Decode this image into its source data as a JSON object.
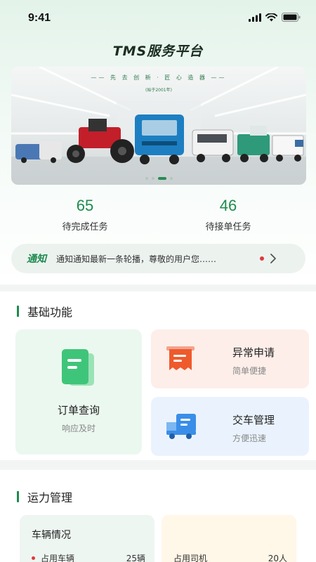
{
  "status": {
    "time": "9:41"
  },
  "app": {
    "title": "TMS服务平台"
  },
  "banner": {
    "slogan": "—— 先 去 创 新 · 匠 心 造 器 ——",
    "subtitle": "(始于2001年)",
    "slide_count": 4,
    "active_slide": 3
  },
  "stats": [
    {
      "value": "65",
      "label": "待完成任务"
    },
    {
      "value": "46",
      "label": "待接单任务"
    }
  ],
  "notice": {
    "tag": "通知",
    "text": "通知通知最新一条轮播，尊敬的用户您……"
  },
  "basic": {
    "title": "基础功能",
    "order_query": {
      "title": "订单查询",
      "subtitle": "响应及时"
    },
    "exception": {
      "title": "异常申请",
      "subtitle": "简单便捷"
    },
    "delivery": {
      "title": "交车管理",
      "subtitle": "方便迅速"
    }
  },
  "capacity": {
    "title": "运力管理",
    "vehicle_status": {
      "title": "车辆情况",
      "occupied_label": "占用车辆",
      "occupied_value": "25辆"
    },
    "second_card": {
      "row_label": "占用司机",
      "row_value": "20人"
    }
  },
  "colors": {
    "primary": "#1e8a4e",
    "accent_red": "#e0383b",
    "orange": "#ef5a2c",
    "blue": "#3a8ee8"
  }
}
